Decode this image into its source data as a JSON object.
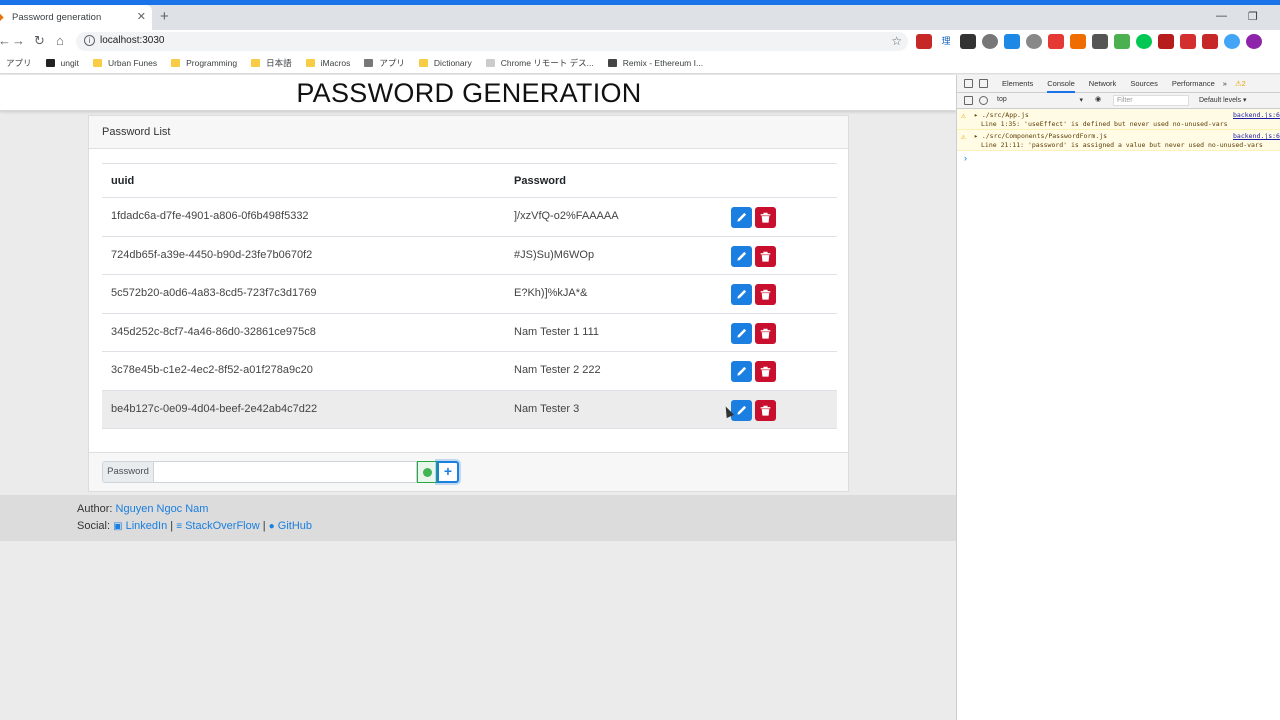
{
  "browser": {
    "tab_title": "Password generation",
    "url": "localhost:3030",
    "bookmarks": [
      "アプリ",
      "ungit",
      "Urban Funes",
      "Programming",
      "日本語",
      "iMacros",
      "アプリ",
      "Dictionary",
      "Chrome リモート デス...",
      "Remix - Ethereum I..."
    ]
  },
  "app": {
    "title": "PASSWORD GENERATION",
    "card_header": "Password List",
    "columns": [
      "uuid",
      "Password"
    ],
    "rows": [
      {
        "uuid": "1fdadc6a-d7fe-4901-a806-0f6b498f5332",
        "password": "]/xzVfQ-o2%FAAAAA"
      },
      {
        "uuid": "724db65f-a39e-4450-b90d-23fe7b0670f2",
        "password": "#JS)Su)M6WOp"
      },
      {
        "uuid": "5c572b20-a0d6-4a83-8cd5-723f7c3d1769",
        "password": "E?Kh)]%kJA*&"
      },
      {
        "uuid": "345d252c-8cf7-4a46-86d0-32861ce975c8",
        "password": "Nam Tester 1 111"
      },
      {
        "uuid": "3c78e45b-c1e2-4ec2-8f52-a01f278a9c20",
        "password": "Nam Tester 2 222"
      },
      {
        "uuid": "be4b127c-0e09-4d04-beef-2e42ab4c7d22",
        "password": "Nam Tester 3"
      }
    ],
    "form": {
      "label": "Password",
      "input_value": "",
      "add_label": "+"
    },
    "footer": {
      "author_label": "Author:",
      "author_name": "Nguyen Ngoc Nam",
      "social_label": "Social:",
      "links": [
        "LinkedIn",
        "StackOverFlow",
        "GitHub"
      ],
      "separator": "|"
    }
  },
  "devtools": {
    "tabs": [
      "Elements",
      "Console",
      "Network",
      "Sources",
      "Performance"
    ],
    "more": "»",
    "warning_count": "2",
    "context": "top",
    "filter_placeholder": "Filter",
    "levels": "Default levels ▾",
    "messages": [
      {
        "file": "./src/App.js",
        "detail": "Line 1:35:  'useEffect' is defined but never used  no-unused-vars",
        "source": "backend.js:6"
      },
      {
        "file": "./src/Components/PasswordForm.js",
        "detail": "Line 21:11:  'password' is assigned a value but never used  no-unused-vars",
        "source": "backend.js:6"
      }
    ]
  }
}
